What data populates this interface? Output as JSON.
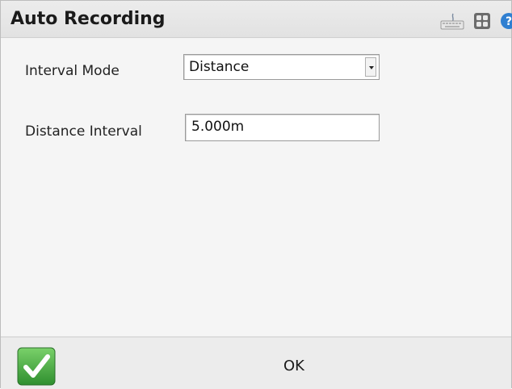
{
  "window": {
    "title": "Auto Recording"
  },
  "toolbar": {
    "icons": [
      "keyboard-icon",
      "grid-icon",
      "help-icon"
    ]
  },
  "form": {
    "interval_mode": {
      "label": "Interval Mode",
      "value": "Distance"
    },
    "distance_interval": {
      "label": "Distance Interval",
      "value": "5.000m"
    }
  },
  "footer": {
    "ok_label": "OK"
  },
  "colors": {
    "accept_green": "#3aa33a"
  }
}
